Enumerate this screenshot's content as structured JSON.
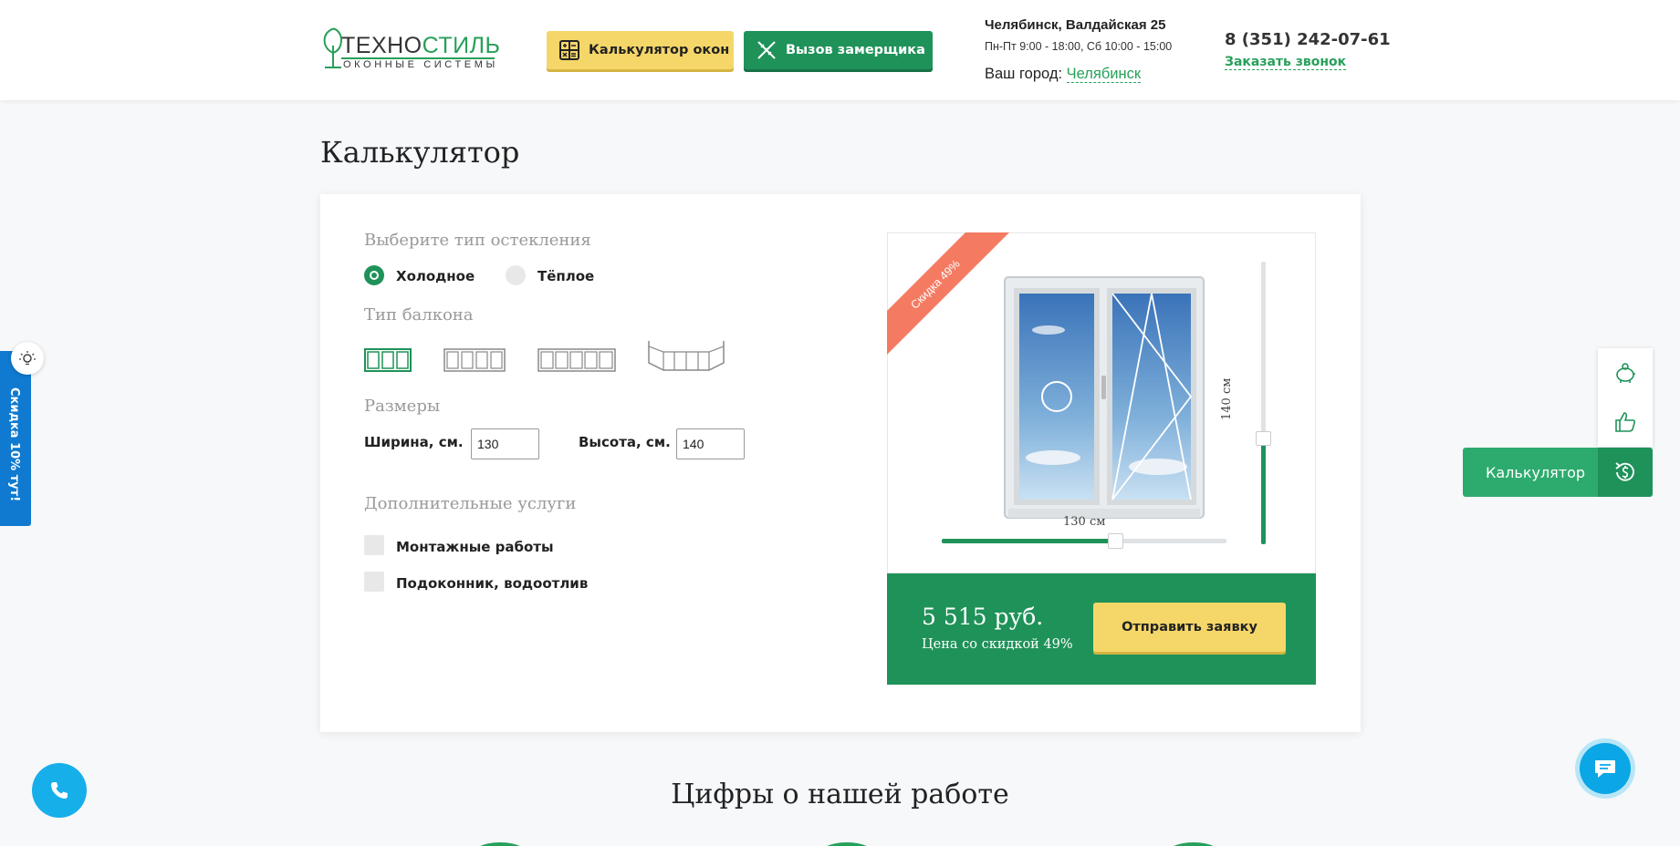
{
  "header": {
    "logo": {
      "word_a": "ТЕХНО",
      "word_b": "СТИЛЬ",
      "tagline": "ОКОННЫЕ СИСТЕМЫ"
    },
    "calc_button": "Калькулятор окон",
    "measure_button": "Вызов замерщика",
    "address": "Челябинск, Валдайская 25",
    "hours": "Пн-Пт 9:00 - 18:00, Сб 10:00 - 15:00",
    "city_prefix": "Ваш город: ",
    "city": "Челябинск",
    "phone": "8 (351) 242-07-61",
    "callback": "Заказать звонок"
  },
  "page_title": "Калькулятор",
  "calculator": {
    "glazing_label": "Выберите тип остекления",
    "glazing_options": [
      {
        "label": "Холодное",
        "selected": true
      },
      {
        "label": "Тёплое",
        "selected": false
      }
    ],
    "balcony_label": "Тип балкона",
    "balcony_types": [
      {
        "id": "3-sash",
        "selected": true
      },
      {
        "id": "4-sash",
        "selected": false
      },
      {
        "id": "5-sash",
        "selected": false
      },
      {
        "id": "angled",
        "selected": false
      }
    ],
    "sizes_label": "Размеры",
    "width_label": "Ширина, см.",
    "width_value": "130",
    "height_label": "Высота, см.",
    "height_value": "140",
    "extras_label": "Дополнительные услуги",
    "extras": [
      {
        "label": "Монтажные работы",
        "checked": false
      },
      {
        "label": "Подоконник, водоотлив",
        "checked": false
      }
    ],
    "ribbon": "Скидка 49%",
    "width_dim": "130 см",
    "height_dim": "140 см",
    "price": "5 515 руб.",
    "price_note": "Цена со скидкой 49%",
    "submit": "Отправить заявку"
  },
  "side_discount": "Скидка 10% тут!",
  "right_widget": {
    "calc_label": "Калькулятор",
    "icons": [
      "piggy-bank-icon",
      "thumbs-up-icon",
      "money-refresh-icon"
    ]
  },
  "section_title": "Цифры о нашей работе",
  "colors": {
    "brand_green": "#1f9259",
    "accent_yellow": "#f5d769",
    "ribbon": "#f47b62",
    "side_blue": "#0f7ad0",
    "fab_blue": "#16afe9"
  }
}
